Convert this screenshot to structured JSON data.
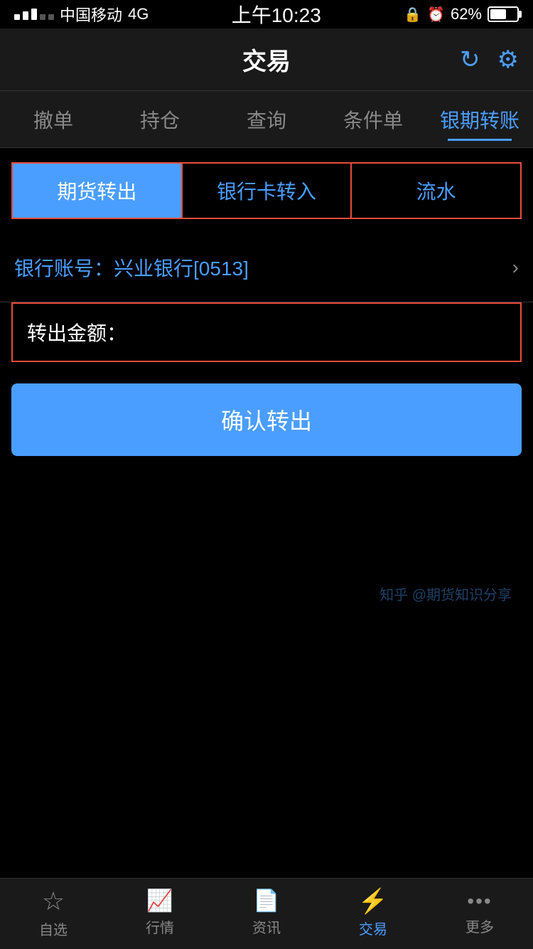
{
  "statusBar": {
    "carrier": "中国移动",
    "network": "4G",
    "time": "上午10:23",
    "battery": "62%"
  },
  "header": {
    "title": "交易",
    "refreshIconLabel": "refresh",
    "settingsIconLabel": "settings"
  },
  "topTabs": [
    {
      "id": "cancel",
      "label": "撤单",
      "active": false
    },
    {
      "id": "position",
      "label": "持仓",
      "active": false
    },
    {
      "id": "query",
      "label": "查询",
      "active": false
    },
    {
      "id": "condition",
      "label": "条件单",
      "active": false
    },
    {
      "id": "transfer",
      "label": "银期转账",
      "active": true
    }
  ],
  "subTabs": [
    {
      "id": "futures-out",
      "label": "期货转出",
      "active": true
    },
    {
      "id": "bank-in",
      "label": "银行卡转入",
      "active": false
    },
    {
      "id": "history",
      "label": "流水",
      "active": false
    }
  ],
  "bankAccount": {
    "label": "银行账号：兴业银行",
    "highlight": "[0513]"
  },
  "amountField": {
    "label": "转出金额：",
    "placeholder": ""
  },
  "confirmButton": {
    "label": "确认转出"
  },
  "bottomNav": [
    {
      "id": "favorites",
      "label": "自选",
      "icon": "☆",
      "active": false
    },
    {
      "id": "market",
      "label": "行情",
      "icon": "📈",
      "active": false
    },
    {
      "id": "news",
      "label": "资讯",
      "icon": "📄",
      "active": false
    },
    {
      "id": "trade",
      "label": "交易",
      "icon": "⚡",
      "active": true
    },
    {
      "id": "more",
      "label": "更多",
      "icon": "···",
      "active": false
    }
  ],
  "watermark": "知乎 @期货知识分享"
}
